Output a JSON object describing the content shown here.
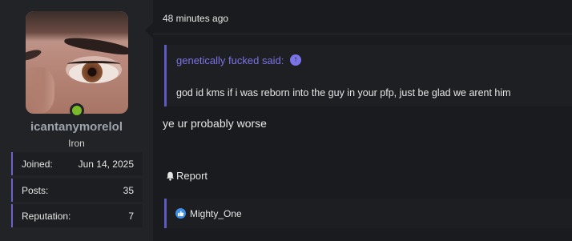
{
  "user": {
    "username": "icantanymorelol",
    "title": "Iron",
    "stats": [
      {
        "key": "Joined:",
        "value": "Jun 14, 2025"
      },
      {
        "key": "Posts:",
        "value": "35"
      },
      {
        "key": "Reputation:",
        "value": "7"
      }
    ],
    "online_color": "#7ab92a"
  },
  "post": {
    "timestamp": "48 minutes ago",
    "quote": {
      "author_label": "genetically fucked said:",
      "text": "god id kms if i was reborn into the guy in your pfp, just be glad we arent him"
    },
    "body": "ye ur probably worse",
    "report_label": "Report",
    "reactions": {
      "user": "Mighty_One",
      "icon": "like-icon"
    }
  },
  "colors": {
    "accent": "#6a63c9",
    "link": "#7a74e6",
    "like": "#3f8ee8"
  }
}
